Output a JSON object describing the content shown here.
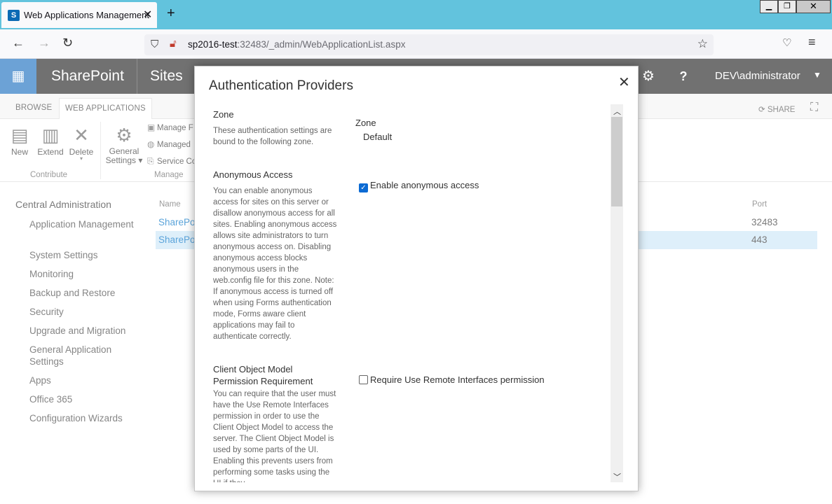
{
  "browser": {
    "tab_title": "Web Applications Management",
    "url_host": "sp2016-test",
    "url_rest": ":32483/_admin/WebApplicationList.aspx"
  },
  "suite": {
    "brand": "SharePoint",
    "sites": "Sites",
    "user": "DEV\\administrator"
  },
  "ribbon": {
    "tabs": [
      "BROWSE",
      "WEB APPLICATIONS"
    ],
    "share": "SHARE",
    "buttons": {
      "new": "New",
      "extend": "Extend",
      "delete": "Delete",
      "general_settings_1": "General",
      "general_settings_2": "Settings"
    },
    "small_cmds": [
      "Manage F",
      "Managed",
      "Service Co"
    ],
    "groups": [
      "Contribute",
      "Manage"
    ]
  },
  "leftnav": {
    "heading": "Central Administration",
    "items": [
      "Application Management",
      "System Settings",
      "Monitoring",
      "Backup and Restore",
      "Security",
      "Upgrade and Migration",
      "General Application Settings",
      "Apps",
      "Office 365",
      "Configuration Wizards"
    ]
  },
  "list": {
    "col_name": "Name",
    "col_port": "Port",
    "rows": [
      {
        "name": "SharePoi",
        "port": "32483"
      },
      {
        "name": "SharePoi",
        "port": "443"
      }
    ]
  },
  "dialog": {
    "title": "Authentication Providers",
    "zone": {
      "title": "Zone",
      "desc": "These authentication settings are bound to the following zone.",
      "label": "Zone",
      "value": "Default"
    },
    "anonymous": {
      "title": "Anonymous Access",
      "desc": "You can enable anonymous access for sites on this server or disallow anonymous access for all sites. Enabling anonymous access allows site administrators to turn anonymous access on. Disabling anonymous access blocks anonymous users in the web.config file for this zone. Note: If anonymous access is turned off when using Forms authentication mode, Forms aware client applications may fail to authenticate correctly.",
      "checkbox_label": "Enable anonymous access",
      "checked": true
    },
    "client_om": {
      "title": "Client Object Model Permission Requirement",
      "desc": "You can require that the user must have the Use Remote Interfaces permission in order to use the Client Object Model to access the server. The Client Object Model is used by some parts of the UI. Enabling this prevents users from performing some tasks using the UI if they",
      "checkbox_label": "Require Use Remote Interfaces permission",
      "checked": false
    }
  }
}
